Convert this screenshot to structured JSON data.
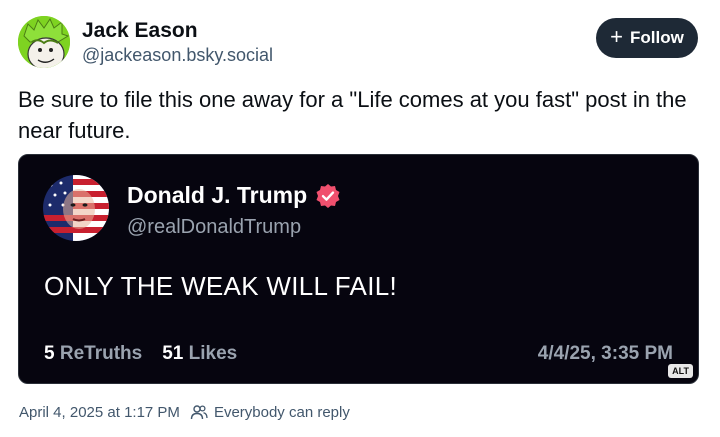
{
  "author": {
    "name": "Jack Eason",
    "handle": "@jackeason.bsky.social",
    "avatar_icon": "cartoon-avatar-icon",
    "avatar_color": "#7ed321"
  },
  "follow_button": {
    "label": "Follow",
    "icon": "plus-icon"
  },
  "post": {
    "text": "Be sure to file this one away for a \"Life comes at you fast\" post in the near future."
  },
  "embed": {
    "name": "Donald J. Trump",
    "handle": "@realDonaldTrump",
    "verified_color": "#f0506e",
    "body": "ONLY THE WEAK WILL FAIL!",
    "retruths_count": "5",
    "retruths_label": "ReTruths",
    "likes_count": "51",
    "likes_label": "Likes",
    "date": "4/4/25, 3:35 PM",
    "alt_badge": "ALT"
  },
  "footer": {
    "timestamp": "April 4, 2025 at 1:17 PM",
    "reply_setting": "Everybody can reply",
    "reply_icon": "people-icon"
  }
}
